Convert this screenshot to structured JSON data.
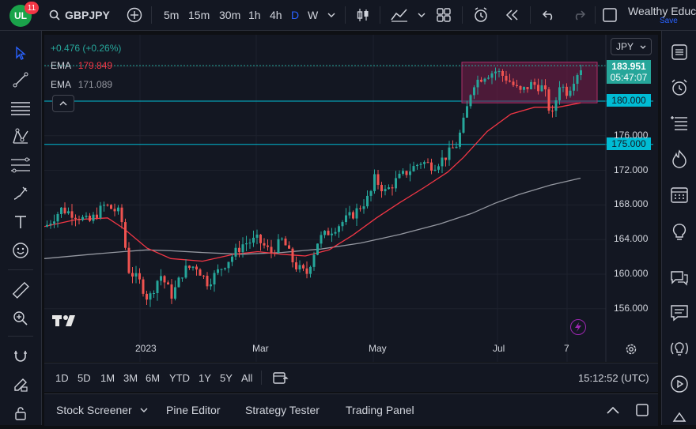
{
  "header": {
    "avatar_initials": "UL",
    "notification_count": "11",
    "symbol": "GBPJPY",
    "intervals": [
      "5m",
      "15m",
      "30m",
      "1h",
      "4h",
      "D",
      "W"
    ],
    "active_interval": "D",
    "account_name": "Wealthy Educ...",
    "save_label": "Save",
    "icons": [
      "add-symbol-icon",
      "chevron-down-icon",
      "candles-icon",
      "indicators-icon",
      "layout-icon",
      "alert-icon",
      "replay-icon",
      "undo-icon",
      "redo-icon",
      "fullscreen-icon"
    ]
  },
  "legend": {
    "change": "+0.476 (+0.26%)",
    "ema1_label": "EMA",
    "ema1_value": "179.849",
    "ema2_label": "EMA",
    "ema2_value": "171.089",
    "collapse_icon": "chevron-up-icon"
  },
  "price_scale": {
    "currency": "JPY",
    "current_price": "183.951",
    "countdown": "05:47:07",
    "level1_label": "180.000",
    "level2_label": "175.000",
    "ticks": [
      "176.000",
      "172.000",
      "168.000",
      "164.000",
      "160.000",
      "156.000"
    ],
    "current_color": "#26a69a",
    "level_color": "#00bcd4"
  },
  "time_axis": {
    "labels": [
      "2023",
      "Mar",
      "May",
      "Jul",
      "7"
    ]
  },
  "watermark": "TradingView",
  "range_bar": {
    "ranges": [
      "1D",
      "5D",
      "1M",
      "3M",
      "6M",
      "YTD",
      "1Y",
      "5Y",
      "All"
    ],
    "clock": "15:12:52 (UTC)"
  },
  "bottom_panel": {
    "tabs": [
      "Stock Screener",
      "Pine Editor",
      "Strategy Tester",
      "Trading Panel"
    ]
  },
  "left_tools": [
    "cursor-icon",
    "trend-line-icon",
    "horizontal-lines-icon",
    "pattern-icon",
    "fib-icon",
    "brush-icon",
    "text-icon",
    "emoji-icon",
    "ruler-icon",
    "zoom-icon",
    "magnet-icon",
    "lock-drawing-icon",
    "lock-icon"
  ],
  "right_tools": [
    "watchlist-icon",
    "alarm-icon",
    "data-window-icon",
    "hotlist-icon",
    "calendar-icon",
    "ideas-icon",
    "chat-icon",
    "notes-icon",
    "signals-icon",
    "replay-panel-icon",
    "help-icon"
  ],
  "colors": {
    "ema_fast": "#f23645",
    "ema_slow": "#9598a1",
    "up": "#26a69a",
    "down": "#ef5350",
    "range_box": "#7b1e4a"
  }
}
